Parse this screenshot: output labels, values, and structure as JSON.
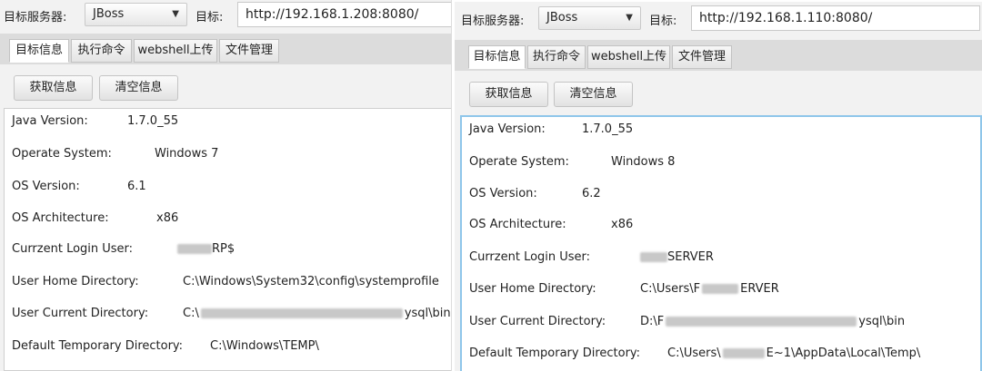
{
  "left": {
    "server_label": "目标服务器:",
    "server_value": "JBoss",
    "target_label": "目标:",
    "target_value": "http://192.168.1.208:8080/",
    "tabs": [
      "目标信息",
      "执行命令",
      "webshell上传",
      "文件管理"
    ],
    "buttons": [
      "获取信息",
      "清空信息"
    ],
    "rows": [
      {
        "key": "Java Version:",
        "value": "1.7.0_55"
      },
      {
        "key": "Operate System:",
        "value": "Windows 7"
      },
      {
        "key": "OS Version:",
        "value": "6.1"
      },
      {
        "key": "OS Architecture:",
        "value": "x86"
      },
      {
        "key": "Currzent Login User:",
        "value": "RP$"
      },
      {
        "key": "User Home Directory:",
        "value": "C:\\Windows\\System32\\config\\systemprofile"
      },
      {
        "key": "User Current Directory:",
        "value_pre": "C:\\",
        "value": "ysql\\bin"
      },
      {
        "key": "Default Temporary Directory:",
        "value": "C:\\Windows\\TEMP\\"
      }
    ]
  },
  "right": {
    "server_label": "目标服务器:",
    "server_value": "JBoss",
    "target_label": "目标:",
    "target_value": "http://192.168.1.110:8080/",
    "tabs": [
      "目标信息",
      "执行命令",
      "webshell上传",
      "文件管理"
    ],
    "buttons": [
      "获取信息",
      "清空信息"
    ],
    "rows": [
      {
        "key": "Java Version:",
        "value": "1.7.0_55"
      },
      {
        "key": "Operate System:",
        "value": "Windows 8"
      },
      {
        "key": "OS Version:",
        "value": "6.2"
      },
      {
        "key": "OS Architecture:",
        "value": "x86"
      },
      {
        "key": "Currzent Login User:",
        "value": "SERVER"
      },
      {
        "key": "User Home Directory:",
        "value_pre": "C:\\Users\\F",
        "value": "ERVER"
      },
      {
        "key": "User Current Directory:",
        "value_pre": "D:\\F",
        "value": "ysql\\bin"
      },
      {
        "key": "Default Temporary Directory:",
        "value_pre": "C:\\Users\\",
        "value": "E~1\\AppData\\Local\\Temp\\"
      }
    ]
  },
  "colors": {
    "focus_border": "#8fc6ea",
    "panel_bg": "#f2f2f2",
    "tabbar_bg": "#dcdcdc"
  }
}
